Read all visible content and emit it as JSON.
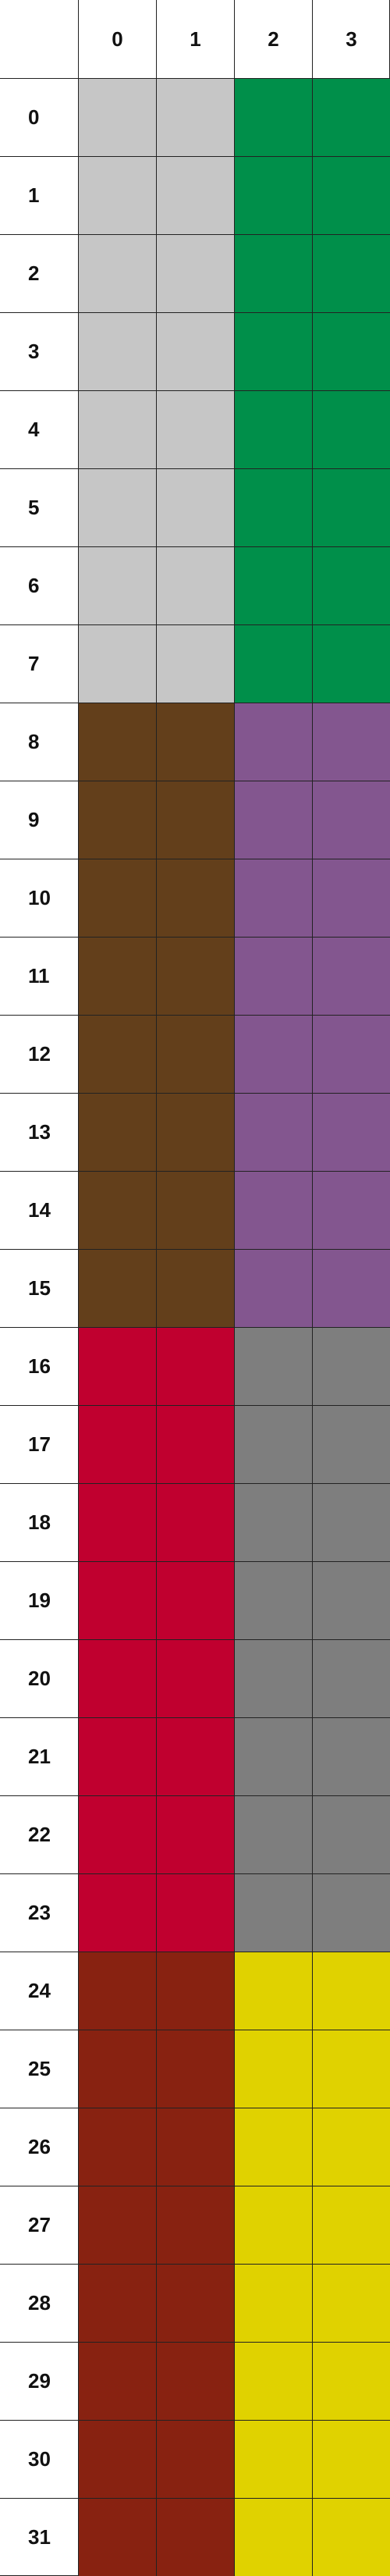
{
  "columns": [
    "0",
    "1",
    "2",
    "3"
  ],
  "rows": [
    "0",
    "1",
    "2",
    "3",
    "4",
    "5",
    "6",
    "7",
    "8",
    "9",
    "10",
    "11",
    "12",
    "13",
    "14",
    "15",
    "16",
    "17",
    "18",
    "19",
    "20",
    "21",
    "22",
    "23",
    "24",
    "25",
    "26",
    "27",
    "28",
    "29",
    "30",
    "31"
  ],
  "colors": {
    "light-gray": "#c6c6c6",
    "green": "#008f4a",
    "brown": "#633f1b",
    "purple": "#83568f",
    "crimson": "#c0002f",
    "gray": "#7e7e7e",
    "rust": "#882211",
    "yellow": "#e0d200"
  },
  "blocks": [
    {
      "rows": [
        0,
        7
      ],
      "left": "light-gray",
      "right": "green"
    },
    {
      "rows": [
        8,
        15
      ],
      "left": "brown",
      "right": "purple"
    },
    {
      "rows": [
        16,
        23
      ],
      "left": "crimson",
      "right": "gray"
    },
    {
      "rows": [
        24,
        31
      ],
      "left": "rust",
      "right": "yellow"
    }
  ]
}
